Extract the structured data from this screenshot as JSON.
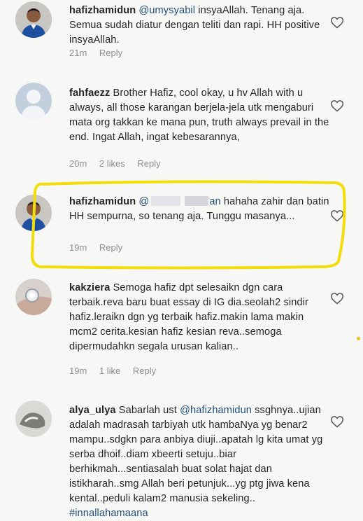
{
  "comments": [
    {
      "username": "hafizhamidun",
      "mention": "@umysyabil",
      "text": " insyaAllah. Tenang aja. Semua sudah diatur dengan teliti dan rapi. HH positive insyaAllah.",
      "time": "21m",
      "likes": "",
      "reply": "Reply"
    },
    {
      "username": "fahfaezz",
      "text": " Brother Hafiz, cool okay, u hv Allah with u always, all those karangan berjela-jela utk mengaburi mata org takkan ke mana pun, truth always prevail in the end. Ingat Allah, ingat kebesarannya,",
      "time": "20m",
      "likes": "2 likes",
      "reply": "Reply"
    },
    {
      "username": "hafizhamidun",
      "mention_prefix": "@",
      "mention_suffix": "an",
      "text": " hahaha zahir dan batin HH sempurna, so tenang aja. Tunggu masanya...",
      "time": "19m",
      "likes": "",
      "reply": "Reply"
    },
    {
      "username": "kakziera",
      "text": " Semoga hafiz dpt selesaikn dgn cara terbaik.reva baru buat essay di IG dia.seolah2 sindir hafiz.leraikn dgn yg terbaik hafiz.makin lama makin mcm2 cerita.kesian hafiz kesian reva..semoga dipermudahkn segala urusan kalian..",
      "time": "19m",
      "likes": "1 like",
      "reply": "Reply"
    },
    {
      "username": "alya_ulya",
      "pre": " Sabarlah ust ",
      "mention": "@hafizhamidun",
      "text": " ssghnya..ujian adalah madrasah tarbiyah utk hambaNya yg benar2 mampu..sdgkn para anbiya diuji..apatah lg kita umat yg serba dhoif..diam xbeerti setuju..biar berhikmah...sentiasalah buat solat hajat dan istikharah..smg Allah beri petunjuk...yg ptg jiwa kena kental..peduli kalam2 manusia sekeling.. ",
      "hashtag": "#innallahamaana"
    }
  ],
  "icons": {
    "like": "heart-outline-icon"
  },
  "colors": {
    "highlight": "#f2dc0a",
    "mention": "#1f4e79",
    "meta": "#8e8e8e"
  }
}
